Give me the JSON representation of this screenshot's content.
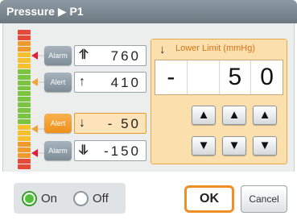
{
  "window": {
    "title": "Pressure ▶ P1"
  },
  "scale": {
    "segments": [
      "#e34a3a",
      "#e34a3a",
      "#f09a2e",
      "#f09a2e",
      "#f6c12f",
      "#f6c12f",
      "#f6c12f",
      "#7cc43f",
      "#7cc43f",
      "#7cc43f",
      "#7cc43f",
      "#7cc43f",
      "#7cc43f",
      "#7cc43f",
      "#7cc43f",
      "#7cc43f",
      "#7cc43f",
      "#f6c12f",
      "#f6c12f",
      "#f6c12f",
      "#f09a2e",
      "#f09a2e",
      "#f09a2e",
      "#e34a3a",
      "#e34a3a"
    ]
  },
  "limits": [
    {
      "button": "Alarm",
      "icon": "upper-upper-limit-icon",
      "glyph": "⥣",
      "value": "760",
      "active": false
    },
    {
      "button": "Alert",
      "icon": "upper-limit-icon",
      "glyph": "↑",
      "value": "410",
      "active": false
    },
    {
      "button": "Alert",
      "icon": "lower-limit-icon",
      "glyph": "↓",
      "value": "- 50",
      "active": true
    },
    {
      "button": "Alarm",
      "icon": "lower-lower-limit-icon",
      "glyph": "⥥",
      "value": "-150",
      "active": false
    }
  ],
  "panel": {
    "title": "Lower Limit (mmHg)",
    "digits": [
      "-",
      "",
      "5",
      "0"
    ],
    "up_glyph": "▲",
    "down_glyph": "▼"
  },
  "toggle": {
    "on_label": "On",
    "off_label": "Off",
    "selected": "On"
  },
  "actions": {
    "ok_label": "OK",
    "cancel_label": "Cancel"
  },
  "colors": {
    "accent": "#ee8e24",
    "alarm": "#e0203a",
    "alert": "#f2a43a",
    "on_green": "#4fc23a"
  }
}
